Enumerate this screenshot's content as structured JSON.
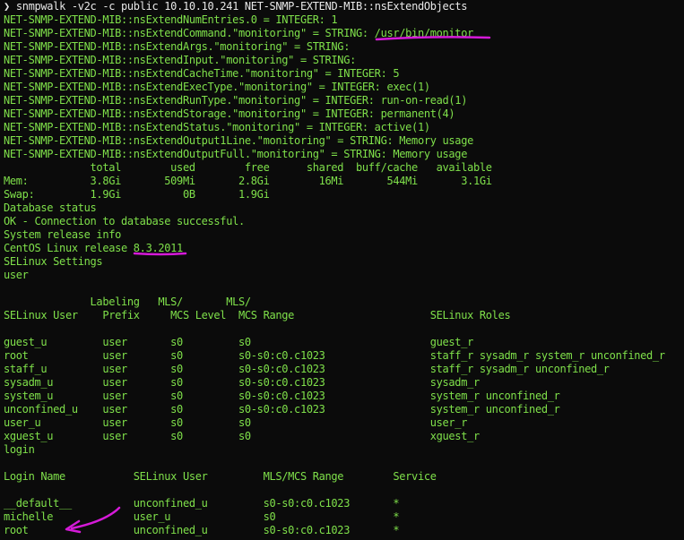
{
  "terminal": {
    "prompt": "❯",
    "command": "snmpwalk -v2c -c public 10.10.10.241 NET-SNMP-EXTEND-MIB::nsExtendObjects",
    "lines": [
      "NET-SNMP-EXTEND-MIB::nsExtendNumEntries.0 = INTEGER: 1",
      "NET-SNMP-EXTEND-MIB::nsExtendCommand.\"monitoring\" = STRING: /usr/bin/monitor",
      "NET-SNMP-EXTEND-MIB::nsExtendArgs.\"monitoring\" = STRING:",
      "NET-SNMP-EXTEND-MIB::nsExtendInput.\"monitoring\" = STRING:",
      "NET-SNMP-EXTEND-MIB::nsExtendCacheTime.\"monitoring\" = INTEGER: 5",
      "NET-SNMP-EXTEND-MIB::nsExtendExecType.\"monitoring\" = INTEGER: exec(1)",
      "NET-SNMP-EXTEND-MIB::nsExtendRunType.\"monitoring\" = INTEGER: run-on-read(1)",
      "NET-SNMP-EXTEND-MIB::nsExtendStorage.\"monitoring\" = INTEGER: permanent(4)",
      "NET-SNMP-EXTEND-MIB::nsExtendStatus.\"monitoring\" = INTEGER: active(1)",
      "NET-SNMP-EXTEND-MIB::nsExtendOutput1Line.\"monitoring\" = STRING: Memory usage",
      "NET-SNMP-EXTEND-MIB::nsExtendOutputFull.\"monitoring\" = STRING: Memory usage",
      "              total        used        free      shared  buff/cache   available",
      "Mem:          3.8Gi       509Mi       2.8Gi        16Mi       544Mi       3.1Gi",
      "Swap:         1.9Gi          0B       1.9Gi",
      "Database status",
      "OK - Connection to database successful.",
      "System release info",
      "CentOS Linux release 8.3.2011",
      "SELinux Settings",
      "user",
      "",
      "              Labeling   MLS/       MLS/",
      "SELinux User    Prefix     MCS Level  MCS Range                      SELinux Roles",
      "",
      "guest_u         user       s0         s0                             guest_r",
      "root            user       s0         s0-s0:c0.c1023                 staff_r sysadm_r system_r unconfined_r",
      "staff_u         user       s0         s0-s0:c0.c1023                 staff_r sysadm_r unconfined_r",
      "sysadm_u        user       s0         s0-s0:c0.c1023                 sysadm_r",
      "system_u        user       s0         s0-s0:c0.c1023                 system_r unconfined_r",
      "unconfined_u    user       s0         s0-s0:c0.c1023                 system_r unconfined_r",
      "user_u          user       s0         s0                             user_r",
      "xguest_u        user       s0         s0                             xguest_r",
      "login",
      "",
      "Login Name           SELinux User         MLS/MCS Range        Service",
      "",
      "__default__          unconfined_u         s0-s0:c0.c1023       *",
      "michelle             user_u               s0                   *",
      "root                 unconfined_u         s0-s0:c0.c1023       *"
    ]
  },
  "colors": {
    "background": "#0b0b0b",
    "output_text": "#7fe04a",
    "command_text": "#e8e8e8",
    "annotation": "#d51ad8"
  }
}
